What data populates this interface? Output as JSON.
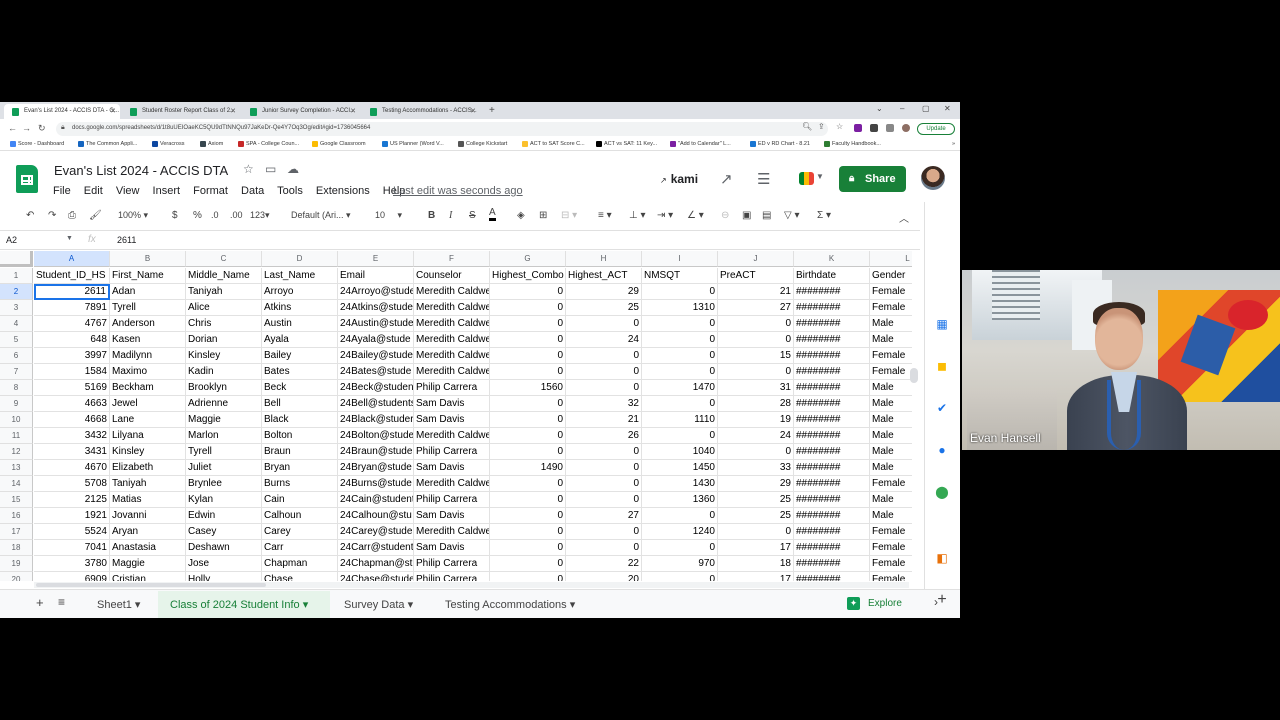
{
  "browser": {
    "tabs": [
      {
        "label": "Evan's List 2024 - ACCIS DTA - G..."
      },
      {
        "label": "Student Roster Report Class of 2..."
      },
      {
        "label": "Junior Survey Completion - ACCI..."
      },
      {
        "label": "Testing Accommodations - ACCIS..."
      }
    ],
    "url": "docs.google.com/spreadsheets/d/1t8uUEIOaeKC5QU9dTtNNQu97JaKeDr-Qe4Y7Oq3Og/edit#gid=1736045664",
    "update_label": "Update",
    "bookmarks": [
      "Score - Dashboard",
      "The Common Appli...",
      "Veracross",
      "Axiom",
      "SPA - College Coun...",
      "Google Classroom",
      "US Planner (Word V...",
      "College Kickstart",
      "ACT to SAT Score C...",
      "ACT vs SAT: 11 Key...",
      "\"Add to Calendar\" L...",
      "ED v RD Chart - 8.21",
      "Faculty Handbook..."
    ]
  },
  "sheets": {
    "title": "Evan's List 2024 - ACCIS DTA",
    "menu": [
      "File",
      "Edit",
      "View",
      "Insert",
      "Format",
      "Data",
      "Tools",
      "Extensions",
      "Help"
    ],
    "last_edit": "Last edit was seconds ago",
    "kami_label": "kami",
    "share_label": "Share",
    "toolbar": {
      "zoom": "100%",
      "currency": "$",
      "percent": "%",
      "dec_less": ".0",
      "dec_more": ".00",
      "more_formats": "123",
      "font": "Default (Ari...",
      "font_size": "10",
      "bold": "B",
      "italic": "I",
      "strike": "S",
      "text_color": "A"
    },
    "formula_bar": {
      "cell_ref": "A2",
      "fx": "fx",
      "value": "2611"
    },
    "columns": [
      {
        "letter": "A",
        "header": "Student_ID_HS"
      },
      {
        "letter": "B",
        "header": "First_Name"
      },
      {
        "letter": "C",
        "header": "Middle_Name"
      },
      {
        "letter": "D",
        "header": "Last_Name"
      },
      {
        "letter": "E",
        "header": "Email"
      },
      {
        "letter": "F",
        "header": "Counselor"
      },
      {
        "letter": "G",
        "header": "Highest_Combo"
      },
      {
        "letter": "H",
        "header": "Highest_ACT"
      },
      {
        "letter": "I",
        "header": "NMSQT"
      },
      {
        "letter": "J",
        "header": "PreACT"
      },
      {
        "letter": "K",
        "header": "Birthdate"
      },
      {
        "letter": "L",
        "header": "Gender"
      }
    ],
    "rows": [
      {
        "n": "2",
        "cells": [
          "2611",
          "Adan",
          "Taniyah",
          "Arroyo",
          "24Arroyo@stude",
          "Meredith Caldwe",
          "0",
          "29",
          "0",
          "21",
          "########",
          "Female"
        ]
      },
      {
        "n": "3",
        "cells": [
          "7891",
          "Tyrell",
          "Alice",
          "Atkins",
          "24Atkins@stude",
          "Meredith Caldwe",
          "0",
          "25",
          "1310",
          "27",
          "########",
          "Female"
        ]
      },
      {
        "n": "4",
        "cells": [
          "4767",
          "Anderson",
          "Chris",
          "Austin",
          "24Austin@stude",
          "Meredith Caldwe",
          "0",
          "0",
          "0",
          "0",
          "########",
          "Male"
        ]
      },
      {
        "n": "5",
        "cells": [
          "648",
          "Kasen",
          "Dorian",
          "Ayala",
          "24Ayala@stude",
          "Meredith Caldwe",
          "0",
          "24",
          "0",
          "0",
          "########",
          "Male"
        ]
      },
      {
        "n": "6",
        "cells": [
          "3997",
          "Madilynn",
          "Kinsley",
          "Bailey",
          "24Bailey@stude",
          "Meredith Caldwe",
          "0",
          "0",
          "0",
          "15",
          "########",
          "Female"
        ]
      },
      {
        "n": "7",
        "cells": [
          "1584",
          "Maximo",
          "Kadin",
          "Bates",
          "24Bates@stude",
          "Meredith Caldwe",
          "0",
          "0",
          "0",
          "0",
          "########",
          "Female"
        ]
      },
      {
        "n": "8",
        "cells": [
          "5169",
          "Beckham",
          "Brooklyn",
          "Beck",
          "24Beck@studen",
          "Philip Carrera",
          "1560",
          "0",
          "1470",
          "31",
          "########",
          "Male"
        ]
      },
      {
        "n": "9",
        "cells": [
          "4663",
          "Jewel",
          "Adrienne",
          "Bell",
          "24Bell@students",
          "Sam Davis",
          "0",
          "32",
          "0",
          "28",
          "########",
          "Male"
        ]
      },
      {
        "n": "10",
        "cells": [
          "4668",
          "Lane",
          "Maggie",
          "Black",
          "24Black@studer",
          "Sam Davis",
          "0",
          "21",
          "1110",
          "19",
          "########",
          "Male"
        ]
      },
      {
        "n": "11",
        "cells": [
          "3432",
          "Lilyana",
          "Marlon",
          "Bolton",
          "24Bolton@stude",
          "Meredith Caldwe",
          "0",
          "26",
          "0",
          "24",
          "########",
          "Male"
        ]
      },
      {
        "n": "12",
        "cells": [
          "3431",
          "Kinsley",
          "Tyrell",
          "Braun",
          "24Braun@stude",
          "Philip Carrera",
          "0",
          "0",
          "1040",
          "0",
          "########",
          "Male"
        ]
      },
      {
        "n": "13",
        "cells": [
          "4670",
          "Elizabeth",
          "Juliet",
          "Bryan",
          "24Bryan@stude",
          "Sam Davis",
          "1490",
          "0",
          "1450",
          "33",
          "########",
          "Male"
        ]
      },
      {
        "n": "14",
        "cells": [
          "5708",
          "Taniyah",
          "Brynlee",
          "Burns",
          "24Burns@stude",
          "Meredith Caldwe",
          "0",
          "0",
          "1430",
          "29",
          "########",
          "Female"
        ]
      },
      {
        "n": "15",
        "cells": [
          "2125",
          "Matias",
          "Kylan",
          "Cain",
          "24Cain@student",
          "Philip Carrera",
          "0",
          "0",
          "1360",
          "25",
          "########",
          "Male"
        ]
      },
      {
        "n": "16",
        "cells": [
          "1921",
          "Jovanni",
          "Edwin",
          "Calhoun",
          "24Calhoun@stu",
          "Sam Davis",
          "0",
          "27",
          "0",
          "25",
          "########",
          "Male"
        ]
      },
      {
        "n": "17",
        "cells": [
          "5524",
          "Aryan",
          "Casey",
          "Carey",
          "24Carey@stude",
          "Meredith Caldwe",
          "0",
          "0",
          "1240",
          "0",
          "########",
          "Female"
        ]
      },
      {
        "n": "18",
        "cells": [
          "7041",
          "Anastasia",
          "Deshawn",
          "Carr",
          "24Carr@student",
          "Sam Davis",
          "0",
          "0",
          "0",
          "17",
          "########",
          "Female"
        ]
      },
      {
        "n": "19",
        "cells": [
          "3780",
          "Maggie",
          "Jose",
          "Chapman",
          "24Chapman@st",
          "Philip Carrera",
          "0",
          "22",
          "970",
          "18",
          "########",
          "Female"
        ]
      },
      {
        "n": "20",
        "cells": [
          "6909",
          "Cristian",
          "Holly",
          "Chase",
          "24Chase@stude",
          "Philip Carrera",
          "0",
          "20",
          "0",
          "17",
          "########",
          "Female"
        ]
      }
    ],
    "sheet_tabs": [
      "Sheet1",
      "Class of 2024 Student Info",
      "Survey Data",
      "Testing Accommodations"
    ],
    "active_sheet_index": 1,
    "explore_label": "Explore",
    "active_cell": "A2"
  },
  "video": {
    "participant_name": "Evan Hansell"
  },
  "colors": {
    "sheets_green": "#188038",
    "selection_blue": "#1a73e8",
    "header_bg": "#f8f9fa"
  }
}
